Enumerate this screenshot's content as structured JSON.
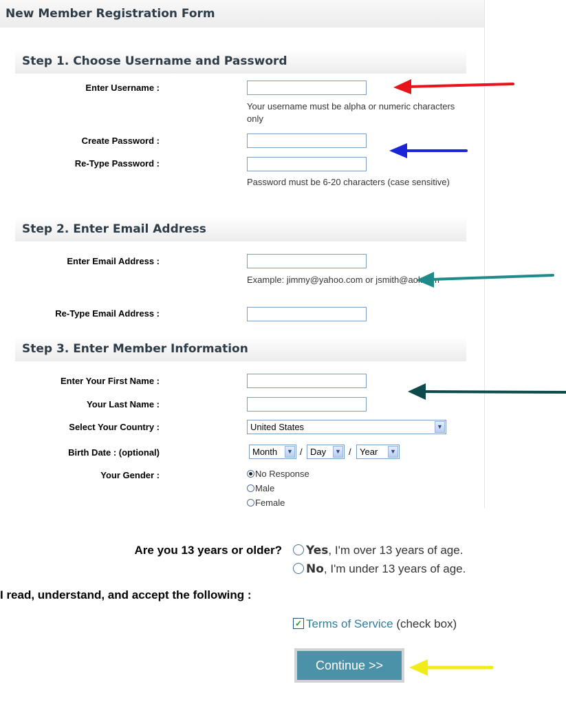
{
  "form": {
    "title": "New Member Registration Form"
  },
  "step1": {
    "heading": "Step 1. Choose Username and Password",
    "username_label": "Enter Username :",
    "username_hint": "Your username must be alpha or numeric characters only",
    "password_label": "Create Password :",
    "retype_password_label": "Re-Type Password :",
    "password_hint": "Password must be 6-20 characters (case sensitive)"
  },
  "step2": {
    "heading": "Step 2. Enter Email Address",
    "email_label": "Enter Email Address :",
    "email_hint": "Example: jimmy@yahoo.com or jsmith@aol.com",
    "retype_email_label": "Re-Type Email Address :"
  },
  "step3": {
    "heading": "Step 3. Enter Member Information",
    "first_name_label": "Enter Your First Name :",
    "last_name_label": "Your Last Name :",
    "country_label": "Select Your Country :",
    "country_value": "United States",
    "birth_label": "Birth Date : (optional)",
    "birth_month": "Month",
    "birth_day": "Day",
    "birth_year": "Year",
    "birth_separator": "/",
    "gender_label": "Your Gender :",
    "gender_options": [
      "No Response",
      "Male",
      "Female"
    ],
    "gender_selected": "No Response"
  },
  "age": {
    "question": "Are you 13 years or older?",
    "yes_word": "Yes",
    "yes_rest": ", I'm over 13 years of age.",
    "no_word": "No",
    "no_rest": ", I'm under 13 years of age."
  },
  "terms": {
    "accept_text": "I read, understand, and accept the following :",
    "link_text": "Terms of Service",
    "suffix": " (check box)",
    "checked": true,
    "check_mark": "✓"
  },
  "continue_label": "Continue >>",
  "arrow_colors": {
    "username": "#e8141c",
    "password": "#1c24d8",
    "email": "#1f8a8a",
    "member_info": "#0f4a4a",
    "continue": "#f0ec1a"
  }
}
